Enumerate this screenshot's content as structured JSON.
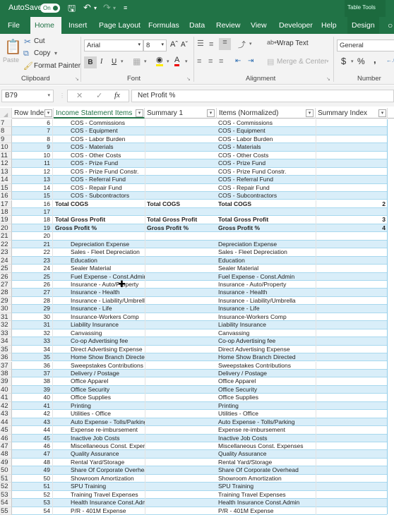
{
  "titlebar": {
    "autosave_label": "AutoSave",
    "autosave_state": "On",
    "table_tools_label": "Table Tools"
  },
  "tabs": [
    {
      "label": "File",
      "active": false
    },
    {
      "label": "Home",
      "active": true
    },
    {
      "label": "Insert",
      "active": false
    },
    {
      "label": "Page Layout",
      "active": false
    },
    {
      "label": "Formulas",
      "active": false
    },
    {
      "label": "Data",
      "active": false
    },
    {
      "label": "Review",
      "active": false
    },
    {
      "label": "View",
      "active": false
    },
    {
      "label": "Developer",
      "active": false
    },
    {
      "label": "Help",
      "active": false
    },
    {
      "label": "Design",
      "active": false
    }
  ],
  "ribbon": {
    "clipboard": {
      "group_label": "Clipboard",
      "paste": "Paste",
      "cut": "Cut",
      "copy": "Copy",
      "format_painter": "Format Painter"
    },
    "font": {
      "group_label": "Font",
      "font_name": "Arial",
      "font_size": "8",
      "bold": "B",
      "italic": "I",
      "underline": "U"
    },
    "alignment": {
      "group_label": "Alignment",
      "wrap_text": "Wrap Text",
      "merge_center": "Merge & Center"
    },
    "number": {
      "group_label": "Number",
      "format": "General",
      "currency": "$",
      "percent": "%",
      "comma": ","
    }
  },
  "formula_bar": {
    "name_box": "B79",
    "fx": "fx",
    "formula": "Net Profit %"
  },
  "columns": [
    {
      "label": "Row Index"
    },
    {
      "label": "Income Statement Items"
    },
    {
      "label": "Summary 1"
    },
    {
      "label": "Items (Normalized)"
    },
    {
      "label": "Summary Index"
    }
  ],
  "rows": [
    {
      "rn": "7",
      "idx": "6",
      "item": "COS - Commissions",
      "sum1": "",
      "norm": "COS - Commissions",
      "sidx": "",
      "bold": false,
      "indent": true
    },
    {
      "rn": "8",
      "idx": "7",
      "item": "COS - Equipment",
      "sum1": "",
      "norm": "COS - Equipment",
      "sidx": "",
      "bold": false,
      "indent": true
    },
    {
      "rn": "9",
      "idx": "8",
      "item": "COS - Labor Burden",
      "sum1": "",
      "norm": "COS - Labor Burden",
      "sidx": "",
      "bold": false,
      "indent": true
    },
    {
      "rn": "10",
      "idx": "9",
      "item": "COS - Materials",
      "sum1": "",
      "norm": "COS - Materials",
      "sidx": "",
      "bold": false,
      "indent": true
    },
    {
      "rn": "11",
      "idx": "10",
      "item": "COS - Other Costs",
      "sum1": "",
      "norm": "COS - Other Costs",
      "sidx": "",
      "bold": false,
      "indent": true
    },
    {
      "rn": "12",
      "idx": "11",
      "item": "COS - Prize Fund",
      "sum1": "",
      "norm": "COS - Prize Fund",
      "sidx": "",
      "bold": false,
      "indent": true
    },
    {
      "rn": "13",
      "idx": "12",
      "item": "COS - Prize Fund Constr.",
      "sum1": "",
      "norm": "COS - Prize Fund Constr.",
      "sidx": "",
      "bold": false,
      "indent": true
    },
    {
      "rn": "14",
      "idx": "13",
      "item": "COS - Referral Fund",
      "sum1": "",
      "norm": "COS - Referral Fund",
      "sidx": "",
      "bold": false,
      "indent": true
    },
    {
      "rn": "15",
      "idx": "14",
      "item": "COS - Repair Fund",
      "sum1": "",
      "norm": "COS - Repair Fund",
      "sidx": "",
      "bold": false,
      "indent": true
    },
    {
      "rn": "16",
      "idx": "15",
      "item": "COS - Subcontractors",
      "sum1": "",
      "norm": "COS - Subcontractors",
      "sidx": "",
      "bold": false,
      "indent": true
    },
    {
      "rn": "17",
      "idx": "16",
      "item": "Total COGS",
      "sum1": "Total COGS",
      "norm": "Total COGS",
      "sidx": "2",
      "bold": true,
      "indent": false
    },
    {
      "rn": "18",
      "idx": "17",
      "item": "",
      "sum1": "",
      "norm": "",
      "sidx": "",
      "bold": false,
      "indent": false
    },
    {
      "rn": "19",
      "idx": "18",
      "item": "Total Gross Profit",
      "sum1": "Total Gross Profit",
      "norm": "Total Gross Profit",
      "sidx": "3",
      "bold": true,
      "indent": false
    },
    {
      "rn": "20",
      "idx": "19",
      "item": "Gross Profit %",
      "sum1": "Gross Profit %",
      "norm": "Gross Profit %",
      "sidx": "4",
      "bold": true,
      "indent": false
    },
    {
      "rn": "21",
      "idx": "20",
      "item": "",
      "sum1": "",
      "norm": "",
      "sidx": "",
      "bold": false,
      "indent": false
    },
    {
      "rn": "22",
      "idx": "21",
      "item": "Depreciation Expense",
      "sum1": "",
      "norm": "Depreciation Expense",
      "sidx": "",
      "bold": false,
      "indent": true
    },
    {
      "rn": "23",
      "idx": "22",
      "item": "Sales - Fleet Depreciation",
      "sum1": "",
      "norm": "Sales - Fleet Depreciation",
      "sidx": "",
      "bold": false,
      "indent": true
    },
    {
      "rn": "24",
      "idx": "23",
      "item": "Education",
      "sum1": "",
      "norm": "Education",
      "sidx": "",
      "bold": false,
      "indent": true
    },
    {
      "rn": "25",
      "idx": "24",
      "item": "Sealer Material",
      "sum1": "",
      "norm": "Sealer Material",
      "sidx": "",
      "bold": false,
      "indent": true
    },
    {
      "rn": "26",
      "idx": "25",
      "item": "Fuel Expense - Const.Admin",
      "sum1": "",
      "norm": "Fuel Expense - Const.Admin",
      "sidx": "",
      "bold": false,
      "indent": true
    },
    {
      "rn": "27",
      "idx": "26",
      "item": "Insurance - Auto/Property",
      "sum1": "",
      "norm": "Insurance - Auto/Property",
      "sidx": "",
      "bold": false,
      "indent": true
    },
    {
      "rn": "28",
      "idx": "27",
      "item": "Insurance - Health",
      "sum1": "",
      "norm": "Insurance - Health",
      "sidx": "",
      "bold": false,
      "indent": true
    },
    {
      "rn": "29",
      "idx": "28",
      "item": "Insurance - Liability/Umbrella",
      "sum1": "",
      "norm": "Insurance - Liability/Umbrella",
      "sidx": "",
      "bold": false,
      "indent": true
    },
    {
      "rn": "30",
      "idx": "29",
      "item": "Insurance - Life",
      "sum1": "",
      "norm": "Insurance - Life",
      "sidx": "",
      "bold": false,
      "indent": true
    },
    {
      "rn": "31",
      "idx": "30",
      "item": "Insurance-Workers Comp",
      "sum1": "",
      "norm": "Insurance-Workers Comp",
      "sidx": "",
      "bold": false,
      "indent": true
    },
    {
      "rn": "32",
      "idx": "31",
      "item": "Liability Insurance",
      "sum1": "",
      "norm": "Liability Insurance",
      "sidx": "",
      "bold": false,
      "indent": true
    },
    {
      "rn": "33",
      "idx": "32",
      "item": "Canvassing",
      "sum1": "",
      "norm": "Canvassing",
      "sidx": "",
      "bold": false,
      "indent": true
    },
    {
      "rn": "34",
      "idx": "33",
      "item": "Co-op Advertising fee",
      "sum1": "",
      "norm": "Co-op Advertising fee",
      "sidx": "",
      "bold": false,
      "indent": true
    },
    {
      "rn": "35",
      "idx": "34",
      "item": "Direct Advertising Expense",
      "sum1": "",
      "norm": "Direct Advertising Expense",
      "sidx": "",
      "bold": false,
      "indent": true
    },
    {
      "rn": "36",
      "idx": "35",
      "item": "Home Show Branch Directed",
      "sum1": "",
      "norm": "Home Show Branch Directed",
      "sidx": "",
      "bold": false,
      "indent": true
    },
    {
      "rn": "37",
      "idx": "36",
      "item": "Sweepstakes Contributions",
      "sum1": "",
      "norm": "Sweepstakes Contributions",
      "sidx": "",
      "bold": false,
      "indent": true
    },
    {
      "rn": "38",
      "idx": "37",
      "item": "Delivery / Postage",
      "sum1": "",
      "norm": "Delivery / Postage",
      "sidx": "",
      "bold": false,
      "indent": true
    },
    {
      "rn": "39",
      "idx": "38",
      "item": "Office Apparel",
      "sum1": "",
      "norm": "Office Apparel",
      "sidx": "",
      "bold": false,
      "indent": true
    },
    {
      "rn": "40",
      "idx": "39",
      "item": "Office Security",
      "sum1": "",
      "norm": "Office Security",
      "sidx": "",
      "bold": false,
      "indent": true
    },
    {
      "rn": "41",
      "idx": "40",
      "item": "Office Supplies",
      "sum1": "",
      "norm": "Office Supplies",
      "sidx": "",
      "bold": false,
      "indent": true
    },
    {
      "rn": "42",
      "idx": "41",
      "item": "Printing",
      "sum1": "",
      "norm": "Printing",
      "sidx": "",
      "bold": false,
      "indent": true
    },
    {
      "rn": "43",
      "idx": "42",
      "item": "Utilities - Office",
      "sum1": "",
      "norm": "Utilities - Office",
      "sidx": "",
      "bold": false,
      "indent": true
    },
    {
      "rn": "44",
      "idx": "43",
      "item": "Auto Expense - Tolls/Parking",
      "sum1": "",
      "norm": "Auto Expense - Tolls/Parking",
      "sidx": "",
      "bold": false,
      "indent": true
    },
    {
      "rn": "45",
      "idx": "44",
      "item": "Expense re-imbursement",
      "sum1": "",
      "norm": "Expense re-imbursement",
      "sidx": "",
      "bold": false,
      "indent": true
    },
    {
      "rn": "46",
      "idx": "45",
      "item": "Inactive Job Costs",
      "sum1": "",
      "norm": "Inactive Job Costs",
      "sidx": "",
      "bold": false,
      "indent": true
    },
    {
      "rn": "47",
      "idx": "46",
      "item": "Miscellaneous Const. Expenses",
      "sum1": "",
      "norm": "Miscellaneous Const. Expenses",
      "sidx": "",
      "bold": false,
      "indent": true
    },
    {
      "rn": "48",
      "idx": "47",
      "item": "Quality Assurance",
      "sum1": "",
      "norm": "Quality Assurance",
      "sidx": "",
      "bold": false,
      "indent": true
    },
    {
      "rn": "49",
      "idx": "48",
      "item": "Rental Yard/Storage",
      "sum1": "",
      "norm": "Rental Yard/Storage",
      "sidx": "",
      "bold": false,
      "indent": true
    },
    {
      "rn": "50",
      "idx": "49",
      "item": "Share Of Corporate Overhead",
      "sum1": "",
      "norm": "Share Of Corporate Overhead",
      "sidx": "",
      "bold": false,
      "indent": true
    },
    {
      "rn": "51",
      "idx": "50",
      "item": "Showroom Amortization",
      "sum1": "",
      "norm": "Showroom Amortization",
      "sidx": "",
      "bold": false,
      "indent": true
    },
    {
      "rn": "52",
      "idx": "51",
      "item": "SPU Training",
      "sum1": "",
      "norm": "SPU Training",
      "sidx": "",
      "bold": false,
      "indent": true
    },
    {
      "rn": "53",
      "idx": "52",
      "item": "Training Travel Expenses",
      "sum1": "",
      "norm": "Training Travel Expenses",
      "sidx": "",
      "bold": false,
      "indent": true
    },
    {
      "rn": "54",
      "idx": "53",
      "item": "Health Insurance Const.Admin",
      "sum1": "",
      "norm": "Health Insurance Const.Admin",
      "sidx": "",
      "bold": false,
      "indent": true
    },
    {
      "rn": "55",
      "idx": "54",
      "item": "P/R - 401M Expense",
      "sum1": "",
      "norm": "P/R - 401M Expense",
      "sidx": "",
      "bold": false,
      "indent": true
    }
  ]
}
